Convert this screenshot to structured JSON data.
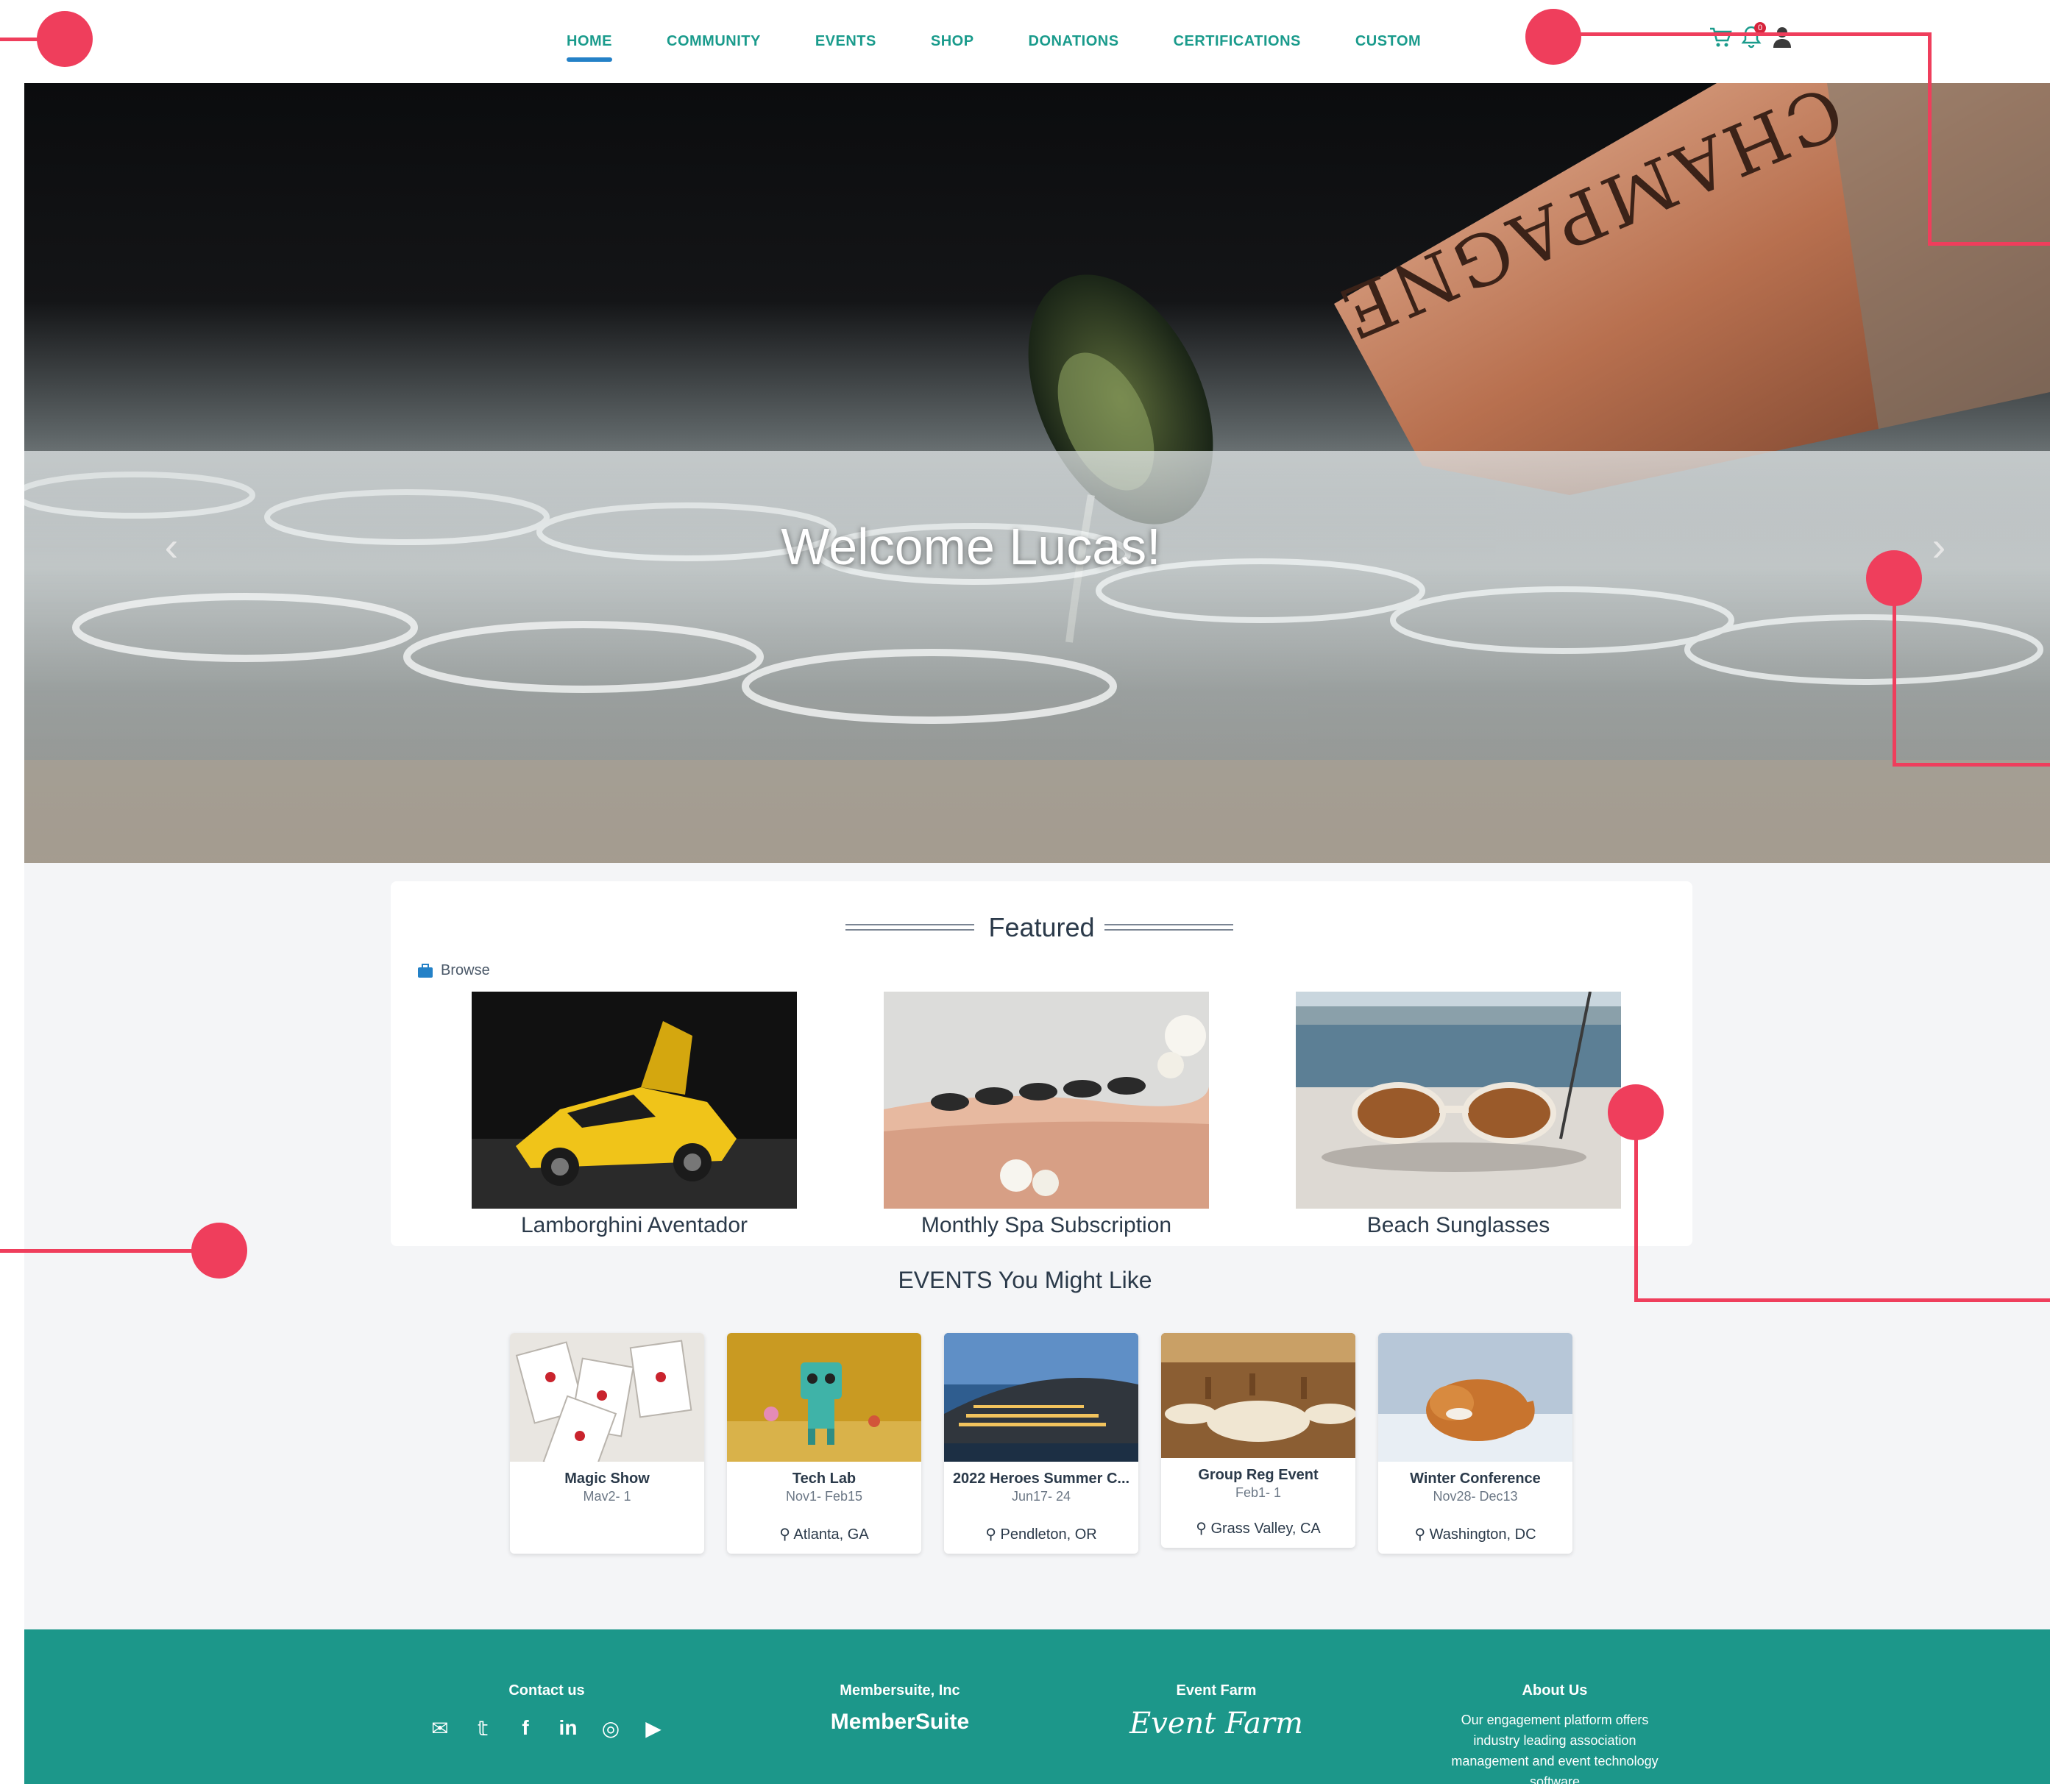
{
  "nav": {
    "items": [
      {
        "label": "HOME",
        "active": true
      },
      {
        "label": "COMMUNITY"
      },
      {
        "label": "EVENTS"
      },
      {
        "label": "SHOP"
      },
      {
        "label": "DONATIONS"
      },
      {
        "label": "CERTIFICATIONS"
      },
      {
        "label": "CUSTOM"
      }
    ],
    "icons": [
      "cart-icon",
      "bell-icon",
      "user-avatar-icon"
    ],
    "notification_count": "0"
  },
  "hero": {
    "welcome": "Welcome Lucas!",
    "bottle_text": "CHAMPAGNE",
    "prev_icon": "‹",
    "next_icon": "›"
  },
  "featured": {
    "title": "Featured",
    "browse_label": "Browse",
    "items": [
      {
        "label": "Lamborghini Aventador",
        "image": "yellow-sports-car"
      },
      {
        "label": "Monthly Spa Subscription",
        "image": "spa-hot-stones"
      },
      {
        "label": "Beach Sunglasses",
        "image": "sunglasses-on-boat"
      }
    ]
  },
  "events": {
    "title": "EVENTS You Might Like",
    "items": [
      {
        "name": "Magic Show",
        "date": "May2- 1",
        "location": "",
        "image": "playing-cards"
      },
      {
        "name": "Tech Lab",
        "date": "Nov1- Feb15",
        "location": "Atlanta, GA",
        "image": "toy-robot"
      },
      {
        "name": "2022 Heroes Summer C...",
        "date": "Jun17- 24",
        "location": "Pendleton, OR",
        "image": "stadium"
      },
      {
        "name": "Group Reg Event",
        "date": "Feb1- 1",
        "location": "Grass Valley, CA",
        "image": "banquet-hall"
      },
      {
        "name": "Winter Conference",
        "date": "Nov28- Dec13",
        "location": "Washington, DC",
        "image": "fox-in-snow"
      }
    ]
  },
  "footer": {
    "contact": {
      "heading": "Contact us",
      "icons": [
        "mail-icon",
        "twitter-icon",
        "facebook-icon",
        "linkedin-icon",
        "instagram-icon",
        "youtube-icon"
      ]
    },
    "membersuite": {
      "heading": "Membersuite, Inc",
      "brand": "MemberSuite"
    },
    "eventfarm": {
      "heading": "Event Farm",
      "brand": "Event Farm"
    },
    "about": {
      "heading": "About Us",
      "text": "Our engagement platform offers industry leading association management and event technology software"
    }
  },
  "colors": {
    "accent": "#1a9b8c",
    "active_underline": "#2481c7",
    "footer": "#1c978a",
    "annotation": "#ef3e5c"
  }
}
